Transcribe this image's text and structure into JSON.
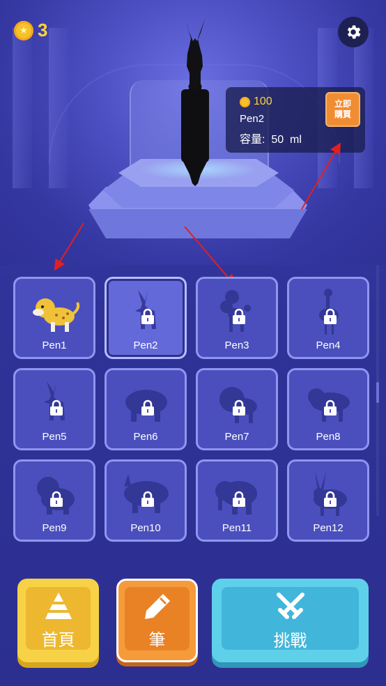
{
  "header": {
    "coin_count": "3"
  },
  "info_card": {
    "price": "100",
    "pen_name": "Pen2",
    "capacity_label": "容量:",
    "capacity_value": "50",
    "capacity_unit": "ml",
    "buy_label": "立即購買"
  },
  "pens": [
    {
      "label": "Pen1",
      "state": "unlocked",
      "animal": "leopard"
    },
    {
      "label": "Pen2",
      "state": "locked",
      "animal": "antelope",
      "selected": true
    },
    {
      "label": "Pen3",
      "state": "locked",
      "animal": "poodle"
    },
    {
      "label": "Pen4",
      "state": "locked",
      "animal": "crane"
    },
    {
      "label": "Pen5",
      "state": "locked",
      "animal": "antelope"
    },
    {
      "label": "Pen6",
      "state": "locked",
      "animal": "hippo"
    },
    {
      "label": "Pen7",
      "state": "locked",
      "animal": "lion"
    },
    {
      "label": "Pen8",
      "state": "locked",
      "animal": "dog"
    },
    {
      "label": "Pen9",
      "state": "locked",
      "animal": "bear"
    },
    {
      "label": "Pen10",
      "state": "locked",
      "animal": "rhino"
    },
    {
      "label": "Pen11",
      "state": "locked",
      "animal": "elephant"
    },
    {
      "label": "Pen12",
      "state": "locked",
      "animal": "oryx"
    }
  ],
  "nav": {
    "home_label": "首頁",
    "pen_label": "筆",
    "challenge_label": "挑戰"
  },
  "colors": {
    "background": "#3437a0",
    "coin": "#f6c12a",
    "home": "#f7d247",
    "pen": "#f59b3b",
    "challenge": "#5fd0ea",
    "annotation_arrow": "#e02020"
  }
}
